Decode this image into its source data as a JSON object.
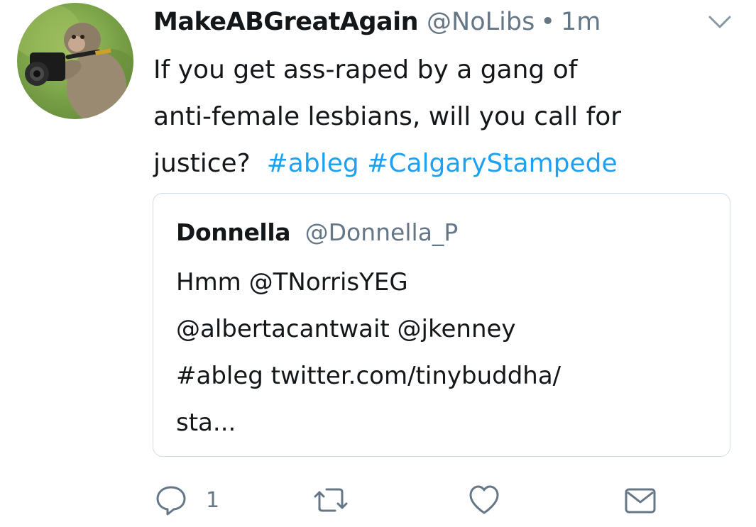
{
  "tweet": {
    "display_name": "MakeABGreatAgain",
    "handle": "@NoLibs",
    "separator": "•",
    "timestamp": "1m",
    "text_lines": [
      "If you get ass-raped by a gang of",
      "anti-female lesbians, will you call for"
    ],
    "text_line3_prefix": "justice?",
    "hashtags": [
      "#ableg",
      "#CalgaryStampede"
    ]
  },
  "quoted_tweet": {
    "display_name": "Donnella",
    "handle": "@Donnella_P",
    "text_lines": [
      "Hmm @TNorrisYEG",
      "@albertacantwait @jkenney",
      "#ableg twitter.com/tinybuddha/",
      "sta..."
    ]
  },
  "actions": {
    "reply_count": "1",
    "retweet_count": "",
    "like_count": ""
  },
  "icons": {
    "caret": "chevron-down-icon",
    "reply": "reply-icon",
    "retweet": "retweet-icon",
    "like": "heart-icon",
    "share": "envelope-icon"
  },
  "colors": {
    "hashtag": "#1da1f2",
    "secondary_text": "#657786",
    "icon": "#657786",
    "border": "#d3dbe2"
  }
}
